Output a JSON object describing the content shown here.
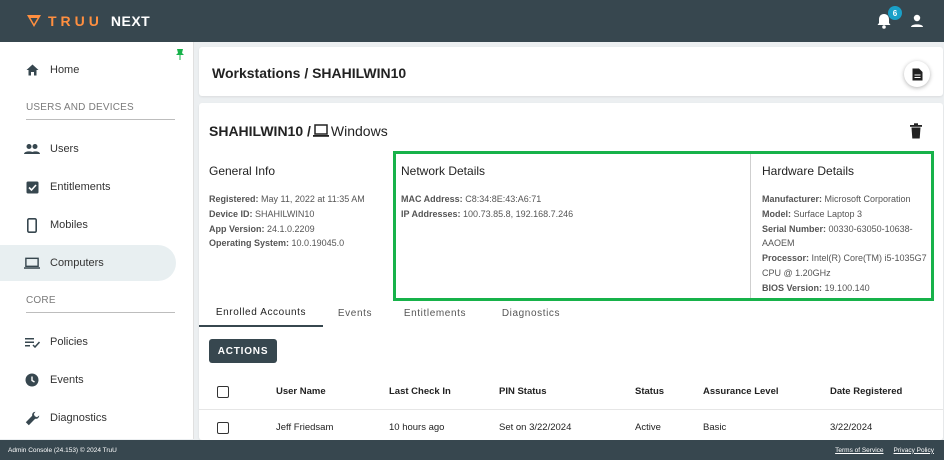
{
  "brand": {
    "word": "TRUU",
    "product": "NEXT",
    "accent": "#ff8f40"
  },
  "header": {
    "notification_count": "6"
  },
  "sidebar": {
    "items_top": [
      {
        "label": "Home",
        "icon": "home-icon"
      }
    ],
    "section_users": "USERS AND DEVICES",
    "items_users": [
      {
        "label": "Users",
        "icon": "people-icon"
      },
      {
        "label": "Entitlements",
        "icon": "checkbox-icon"
      },
      {
        "label": "Mobiles",
        "icon": "mobile-icon"
      },
      {
        "label": "Computers",
        "icon": "laptop-icon"
      }
    ],
    "section_core": "CORE",
    "items_core": [
      {
        "label": "Policies",
        "icon": "policy-list-icon"
      },
      {
        "label": "Events",
        "icon": "clock-icon"
      },
      {
        "label": "Diagnostics",
        "icon": "wrench-icon"
      }
    ]
  },
  "page": {
    "breadcrumb": "Workstations / SHAHILWIN10"
  },
  "device": {
    "name": "SHAHILWIN10 /",
    "os": "Windows"
  },
  "general": {
    "heading": "General Info",
    "lines": [
      {
        "label": "Registered:",
        "value": "May 11, 2022 at 11:35 AM"
      },
      {
        "label": "Device ID:",
        "value": "SHAHILWIN10"
      },
      {
        "label": "App Version:",
        "value": "24.1.0.2209"
      },
      {
        "label": "Operating System:",
        "value": "10.0.19045.0"
      }
    ]
  },
  "network": {
    "heading": "Network Details",
    "lines": [
      {
        "label": "MAC Address:",
        "value": "C8:34:8E:43:A6:71"
      },
      {
        "label": "IP Addresses:",
        "value": "100.73.85.8, 192.168.7.246"
      }
    ]
  },
  "hardware": {
    "heading": "Hardware Details",
    "lines": [
      {
        "label": "Manufacturer:",
        "value": "Microsoft Corporation"
      },
      {
        "label": "Model:",
        "value": "Surface Laptop 3"
      },
      {
        "label": "Serial Number:",
        "value": "00330-63050-10638-AAOEM"
      },
      {
        "label": "Processor:",
        "value": "Intel(R) Core(TM) i5-1035G7 CPU @ 1.20GHz"
      },
      {
        "label": "BIOS Version:",
        "value": "19.100.140"
      }
    ]
  },
  "tabs": [
    "Enrolled Accounts",
    "Events",
    "Entitlements",
    "Diagnostics"
  ],
  "actions_label": "ACTIONS",
  "table": {
    "headers": [
      "User Name",
      "Last Check In",
      "PIN Status",
      "Status",
      "Assurance Level",
      "Date Registered"
    ],
    "rows": [
      [
        "Jeff Friedsam",
        "10 hours ago",
        "Set on 3/22/2024",
        "Active",
        "Basic",
        "3/22/2024"
      ]
    ]
  },
  "footer": {
    "left": "Admin Console (24.153) © 2024 TruU",
    "terms": "Terms of Service",
    "privacy": "Privacy Policy"
  },
  "colors": {
    "topbar": "#37474f",
    "highlight": "#17b24a",
    "badge": "#1aa0c8"
  }
}
